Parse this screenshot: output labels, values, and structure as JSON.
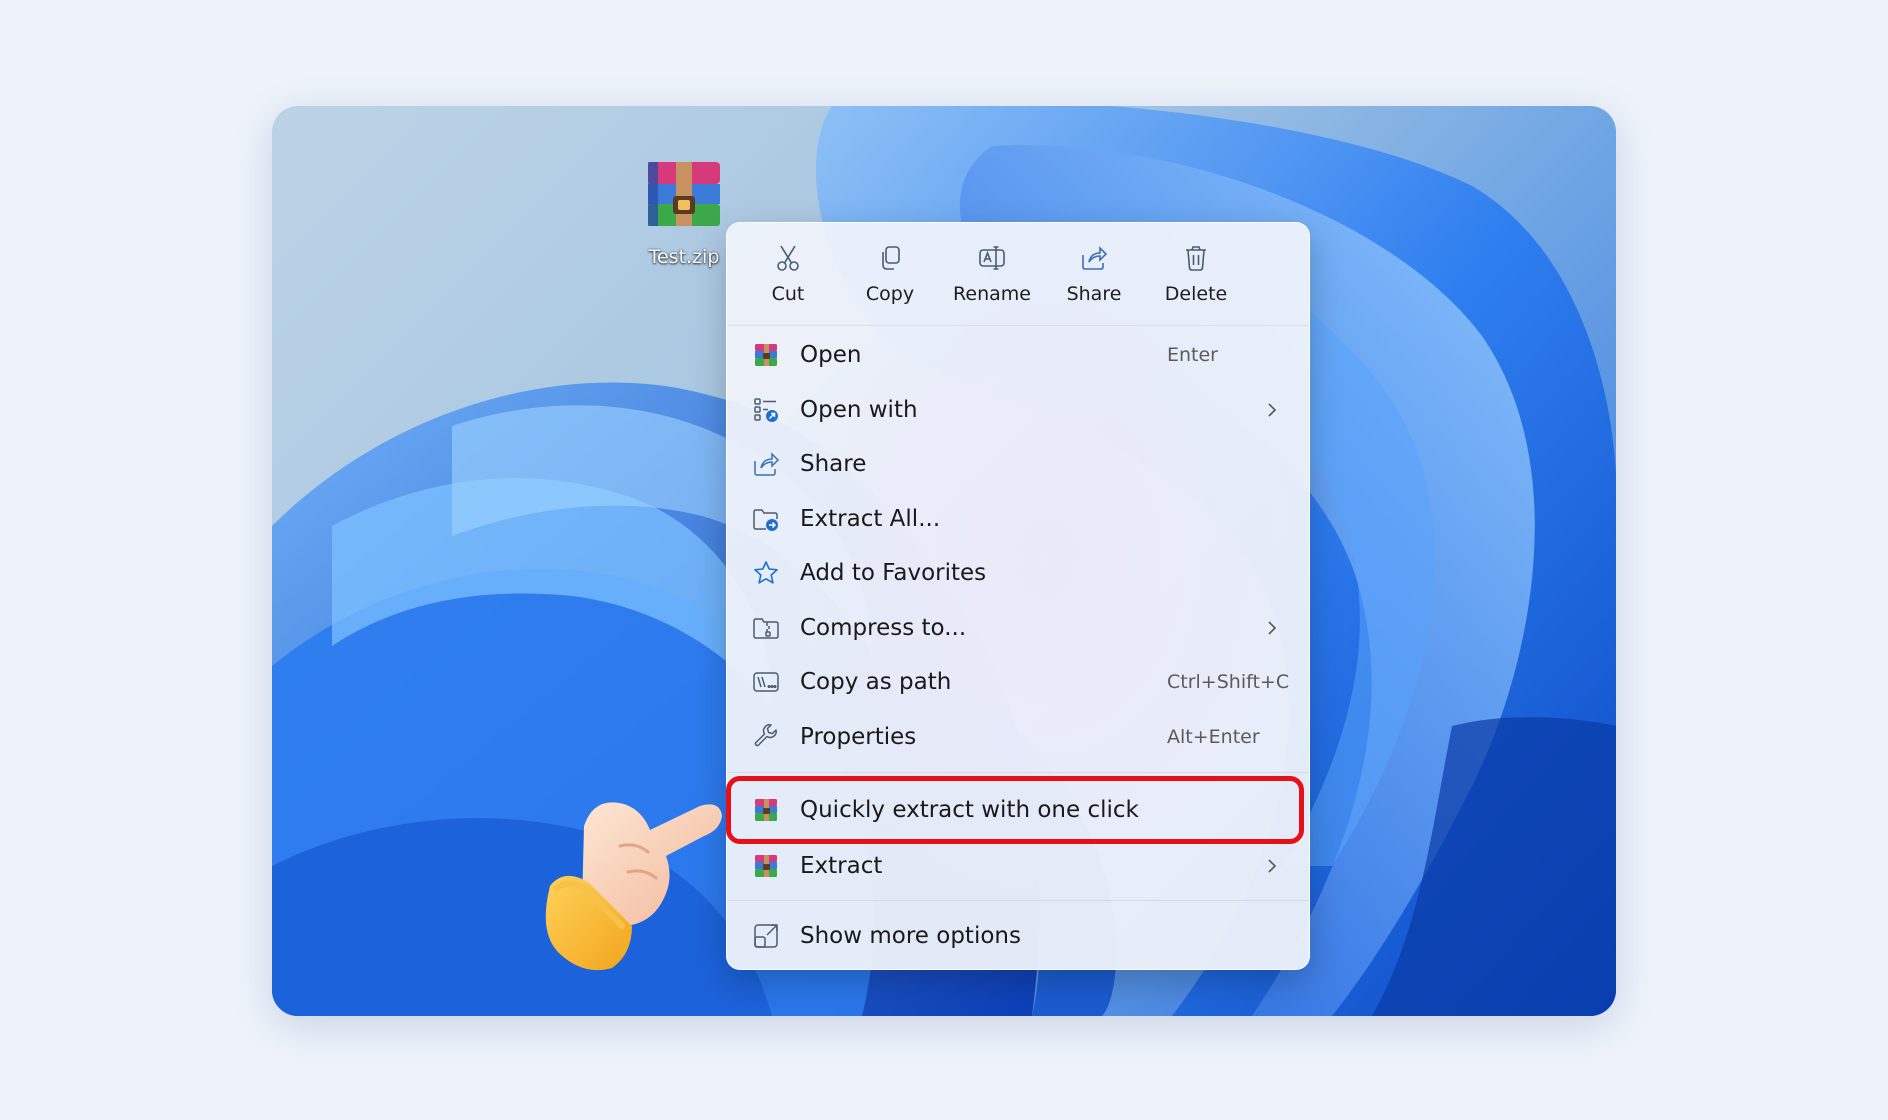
{
  "desktop": {
    "file_icon": "winrar-archive-icon",
    "file_name": "Test.zip"
  },
  "context_menu": {
    "quick_actions": [
      {
        "label": "Cut",
        "icon": "scissors-icon"
      },
      {
        "label": "Copy",
        "icon": "copy-icon"
      },
      {
        "label": "Rename",
        "icon": "rename-icon"
      },
      {
        "label": "Share",
        "icon": "share-icon"
      },
      {
        "label": "Delete",
        "icon": "trash-icon"
      }
    ],
    "items": [
      {
        "label": "Open",
        "shortcut": "Enter",
        "icon": "winrar-icon"
      },
      {
        "label": "Open with",
        "submenu": true,
        "icon": "open-with-icon"
      },
      {
        "label": "Share",
        "icon": "share-icon"
      },
      {
        "label": "Extract All...",
        "icon": "extract-folder-icon"
      },
      {
        "label": "Add to Favorites",
        "icon": "star-icon"
      },
      {
        "label": "Compress to...",
        "submenu": true,
        "icon": "zip-folder-icon"
      },
      {
        "label": "Copy as path",
        "shortcut": "Ctrl+Shift+C",
        "icon": "path-icon"
      },
      {
        "label": "Properties",
        "shortcut": "Alt+Enter",
        "icon": "wrench-icon"
      }
    ],
    "winrar_items": [
      {
        "label": "Quickly extract with one click",
        "highlighted": true,
        "icon": "winrar-icon"
      },
      {
        "label": "Extract",
        "submenu": true,
        "icon": "winrar-icon"
      }
    ],
    "footer_item": {
      "label": "Show more options",
      "icon": "show-more-icon"
    }
  },
  "colors": {
    "highlight_ring": "#e81018",
    "icon_blue": "#1f6fd1"
  }
}
